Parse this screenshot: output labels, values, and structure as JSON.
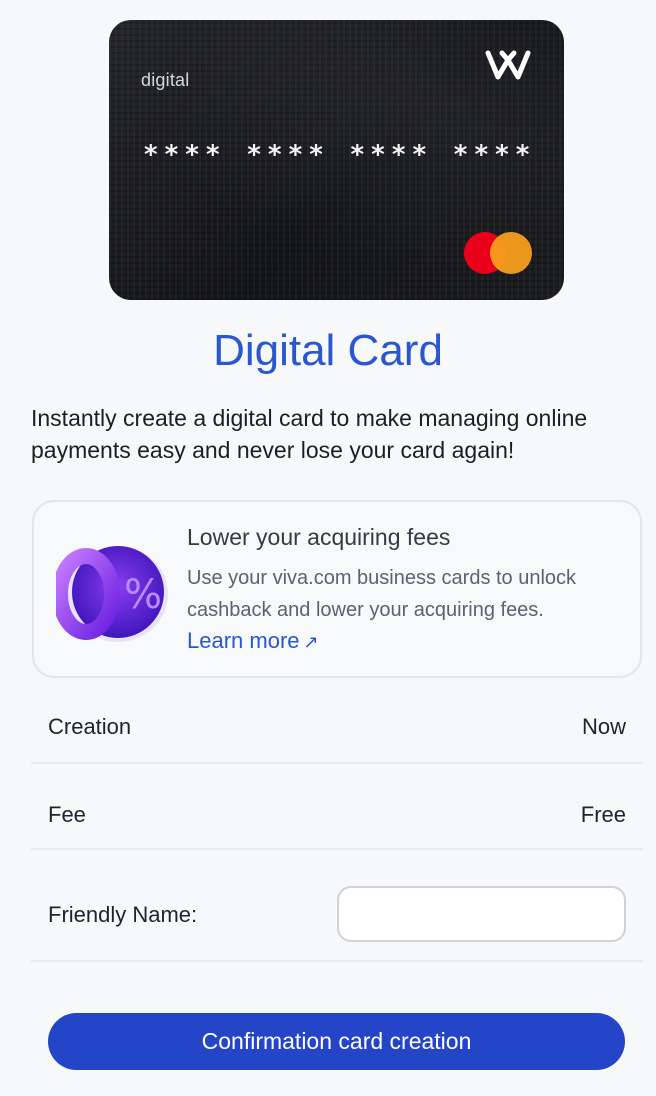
{
  "card": {
    "type_label": "digital",
    "number_masked": "**** **** **** ****",
    "brand_icon": "viva-w-logo-icon",
    "network_icon": "mastercard-logo-icon"
  },
  "title": "Digital Card",
  "description": "Instantly create a digital card to make managing online payments easy and never lose your card again!",
  "promo": {
    "icon": "zero-percent-icon",
    "title": "Lower your acquiring fees",
    "body": "Use your viva.com business cards to unlock cashback and lower your acquiring fees.",
    "link_label": "Learn more",
    "link_icon": "arrow-up-right-icon"
  },
  "details": [
    {
      "label": "Creation",
      "value": "Now"
    },
    {
      "label": "Fee",
      "value": "Free"
    }
  ],
  "friendly_name": {
    "label": "Friendly Name:",
    "value": ""
  },
  "confirm_button": "Confirmation card creation",
  "colors": {
    "accent": "#2a57cf",
    "button": "#2445c7",
    "background": "#f7f8fa"
  }
}
